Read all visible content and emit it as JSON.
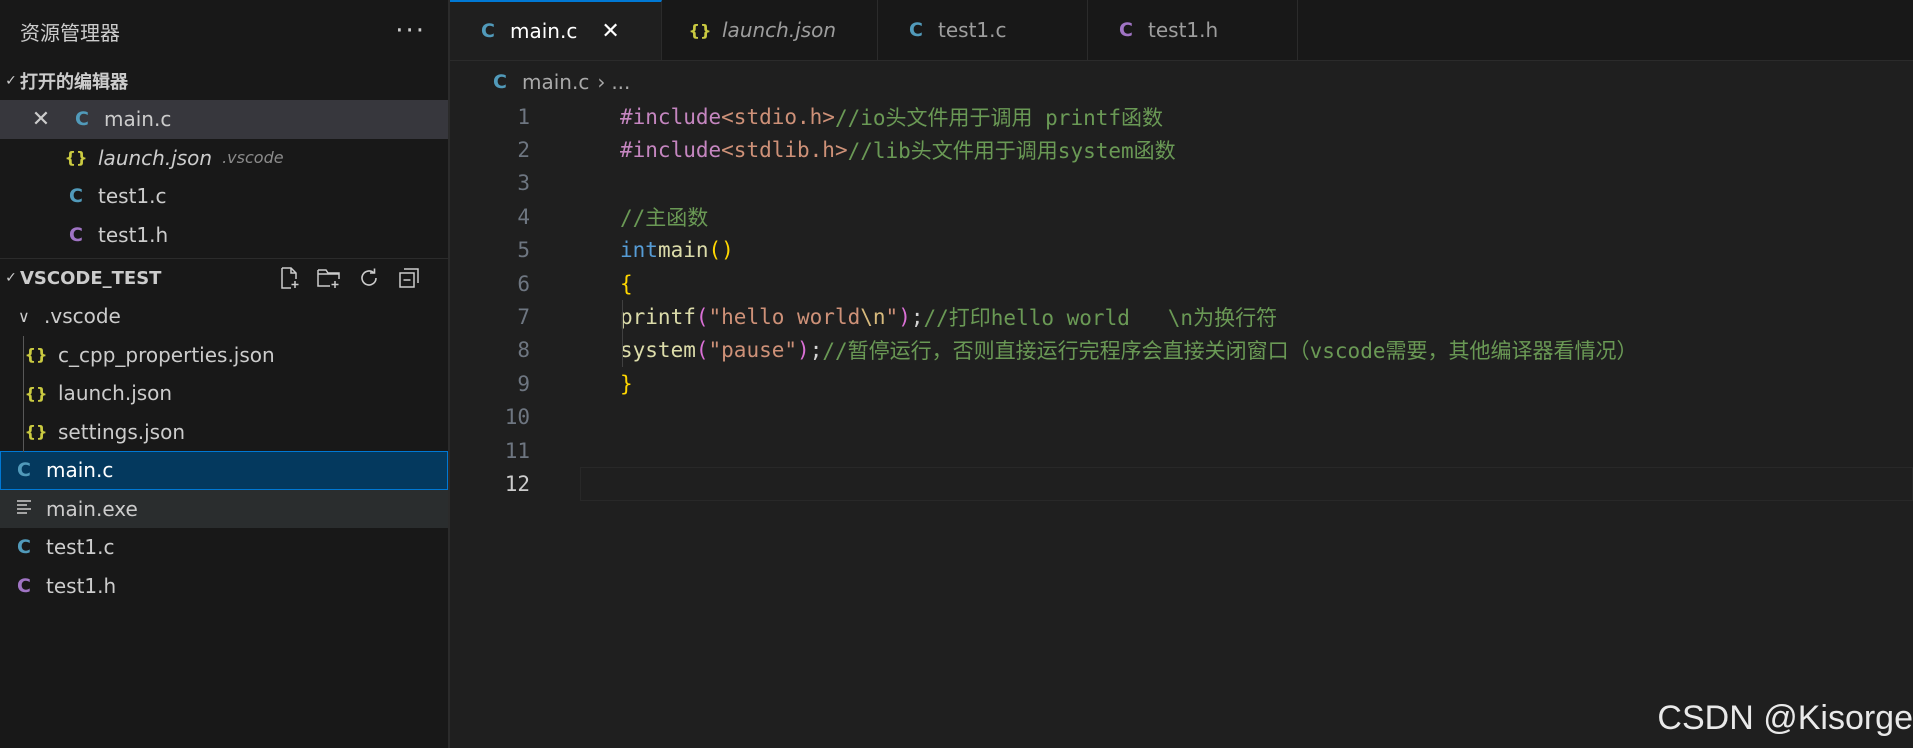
{
  "explorer": {
    "title": "资源管理器",
    "more": "···",
    "open_editors": {
      "title": "打开的编辑器",
      "items": [
        {
          "name": "main.c",
          "type": "c",
          "desc": ""
        },
        {
          "name": "launch.json",
          "type": "json",
          "desc": ".vscode"
        },
        {
          "name": "test1.c",
          "type": "c",
          "desc": ""
        },
        {
          "name": "test1.h",
          "type": "h",
          "desc": ""
        }
      ]
    },
    "workspace": {
      "title": "VSCODE_TEST",
      "folder": ".vscode",
      "folder_items": [
        "c_cpp_properties.json",
        "launch.json",
        "settings.json"
      ],
      "files": [
        "main.c",
        "main.exe",
        "test1.c",
        "test1.h"
      ]
    }
  },
  "tabs": [
    {
      "label": "main.c",
      "type": "c",
      "active": true
    },
    {
      "label": "launch.json",
      "type": "json",
      "active": false
    },
    {
      "label": "test1.c",
      "type": "c",
      "active": false
    },
    {
      "label": "test1.h",
      "type": "h",
      "active": false
    }
  ],
  "breadcrumb": {
    "file": "main.c",
    "rest": "..."
  },
  "code": {
    "line_numbers": [
      "1",
      "2",
      "3",
      "4",
      "5",
      "6",
      "7",
      "8",
      "9",
      "10",
      "11",
      "12"
    ],
    "l1": {
      "kw": "#include",
      "hdr": "<stdio.h>",
      "cm": "//io头文件用于调用 printf函数"
    },
    "l2": {
      "kw": "#include",
      "hdr": "<stdlib.h>",
      "cm": "//lib头文件用于调用system函数"
    },
    "l4": {
      "cm": "//主函数"
    },
    "l5": {
      "type": "int",
      "fn": "main",
      "parens": "()"
    },
    "l6": {
      "brace": "{"
    },
    "l7": {
      "fn": "printf",
      "str1": "\"hello world",
      "esc": "\\n",
      "str2": "\"",
      "cm": "//打印hello world   \\n为换行符"
    },
    "l8": {
      "fn": "system",
      "str": "\"pause\"",
      "cm": "//暂停运行，否则直接运行完程序会直接关闭窗口（vscode需要，其他编译器看情况）"
    },
    "l9": {
      "brace": "}"
    }
  },
  "watermark": "CSDN @Kisorge"
}
